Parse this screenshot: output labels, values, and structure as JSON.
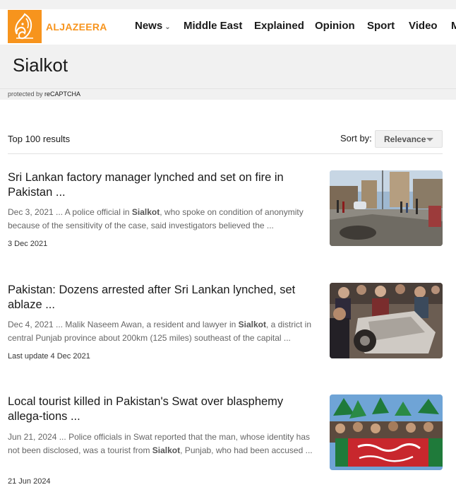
{
  "brand": {
    "name": "ALJAZEERA",
    "color": "#f7941d"
  },
  "nav": {
    "items": [
      {
        "label": "News",
        "has_dropdown": true
      },
      {
        "label": "Middle East"
      },
      {
        "label": "Explained"
      },
      {
        "label": "Opinion"
      },
      {
        "label": "Sport"
      },
      {
        "label": "Video"
      },
      {
        "label": "M"
      }
    ]
  },
  "search": {
    "term": "Sialkot"
  },
  "captcha": {
    "prefix": "protected by ",
    "brand": "reCAPTCHA"
  },
  "results": {
    "count_label": "Top 100 results",
    "sort_label": "Sort by:",
    "sort_value": "Relevance"
  },
  "articles": [
    {
      "title": "Sri Lankan factory manager lynched and set on fire in Pakistan ...",
      "excerpt_before": "Dec 3, 2021 ... A police official in ",
      "highlight": "Sialkot",
      "excerpt_after": ", who spoke on condition of anonymity because of the sensitivity of the case, said investigators believed the ...",
      "date": "3 Dec 2021",
      "thumb_icon": "street-scene-image"
    },
    {
      "title": "Pakistan: Dozens arrested after Sri Lankan lynched, set ablaze ...",
      "excerpt_before": "Dec 4, 2021 ... Malik Naseem Awan, a resident and lawyer in ",
      "highlight": "Sialkot",
      "excerpt_after": ", a district in central Punjab province about 200km (125 miles) southeast of the capital ...",
      "date": "Last update 4 Dec 2021",
      "thumb_icon": "overturned-car-image"
    },
    {
      "title": "Local tourist killed in Pakistan's Swat over blasphemy allega-tions ...",
      "excerpt_before": "Jun 21, 2024 ... Police officials in Swat reported that the man, whose identity has not been disclosed, was a tourist from ",
      "highlight": "Sialkot",
      "excerpt_after": ", Punjab, who had been accused ...",
      "date": "21 Jun 2024",
      "thumb_icon": "protest-crowd-image"
    }
  ]
}
